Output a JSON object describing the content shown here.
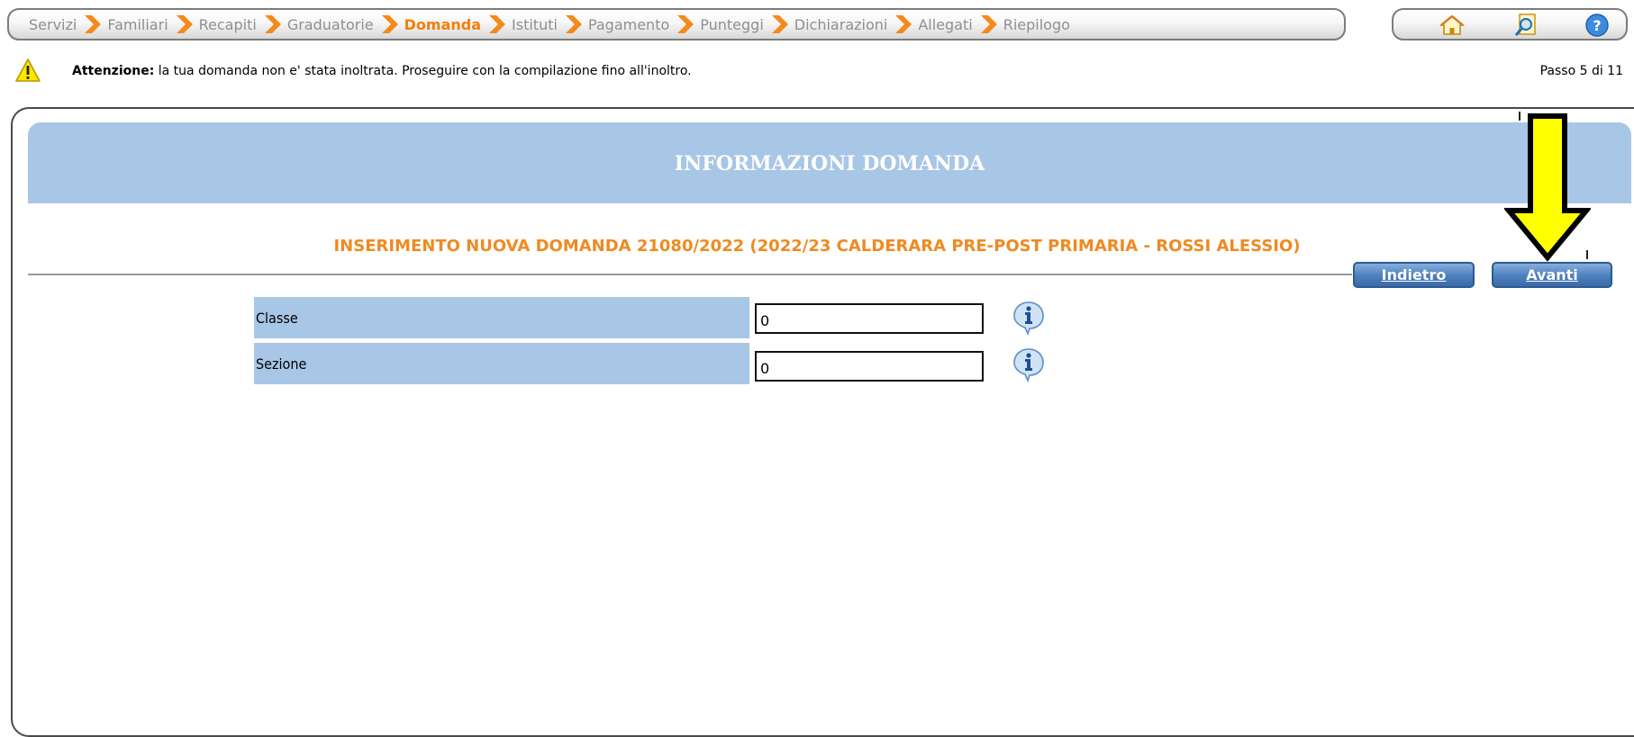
{
  "stepbar": {
    "steps": [
      {
        "label": "Servizi"
      },
      {
        "label": "Familiari"
      },
      {
        "label": "Recapiti"
      },
      {
        "label": "Graduatorie"
      },
      {
        "label": "Domanda",
        "current": true
      },
      {
        "label": "Istituti"
      },
      {
        "label": "Pagamento"
      },
      {
        "label": "Punteggi"
      },
      {
        "label": "Dichiarazioni"
      },
      {
        "label": "Allegati"
      },
      {
        "label": "Riepilogo"
      }
    ],
    "separator_color": "#f5891b",
    "current_color": "#f07f0a"
  },
  "toolbar": {
    "icons": [
      "home-icon",
      "search-document-icon",
      "help-icon"
    ]
  },
  "warning": {
    "icon": "warning-icon",
    "bold": "Attenzione:",
    "text": " la tua domanda non e' stata inoltrata. Proseguire con la compilazione fino all'inoltro."
  },
  "passo": "Passo 5 di 11",
  "banner_title": "INFORMAZIONI DOMANDA",
  "subtitle": "INSERIMENTO NUOVA DOMANDA 21080/2022 (2022/23 CALDERARA PRE-POST PRIMARIA - ROSSI ALESSIO)",
  "buttons": {
    "indietro": "Indietro",
    "avanti": "Avanti"
  },
  "form": {
    "rows": [
      {
        "label": "Classe",
        "value": "0"
      },
      {
        "label": "Sezione",
        "value": "0"
      }
    ]
  },
  "colors": {
    "banner": "#a8c6e6",
    "subtitle": "#ef8a21",
    "button": "#4d7fbd",
    "arrow": "#ffff00"
  }
}
